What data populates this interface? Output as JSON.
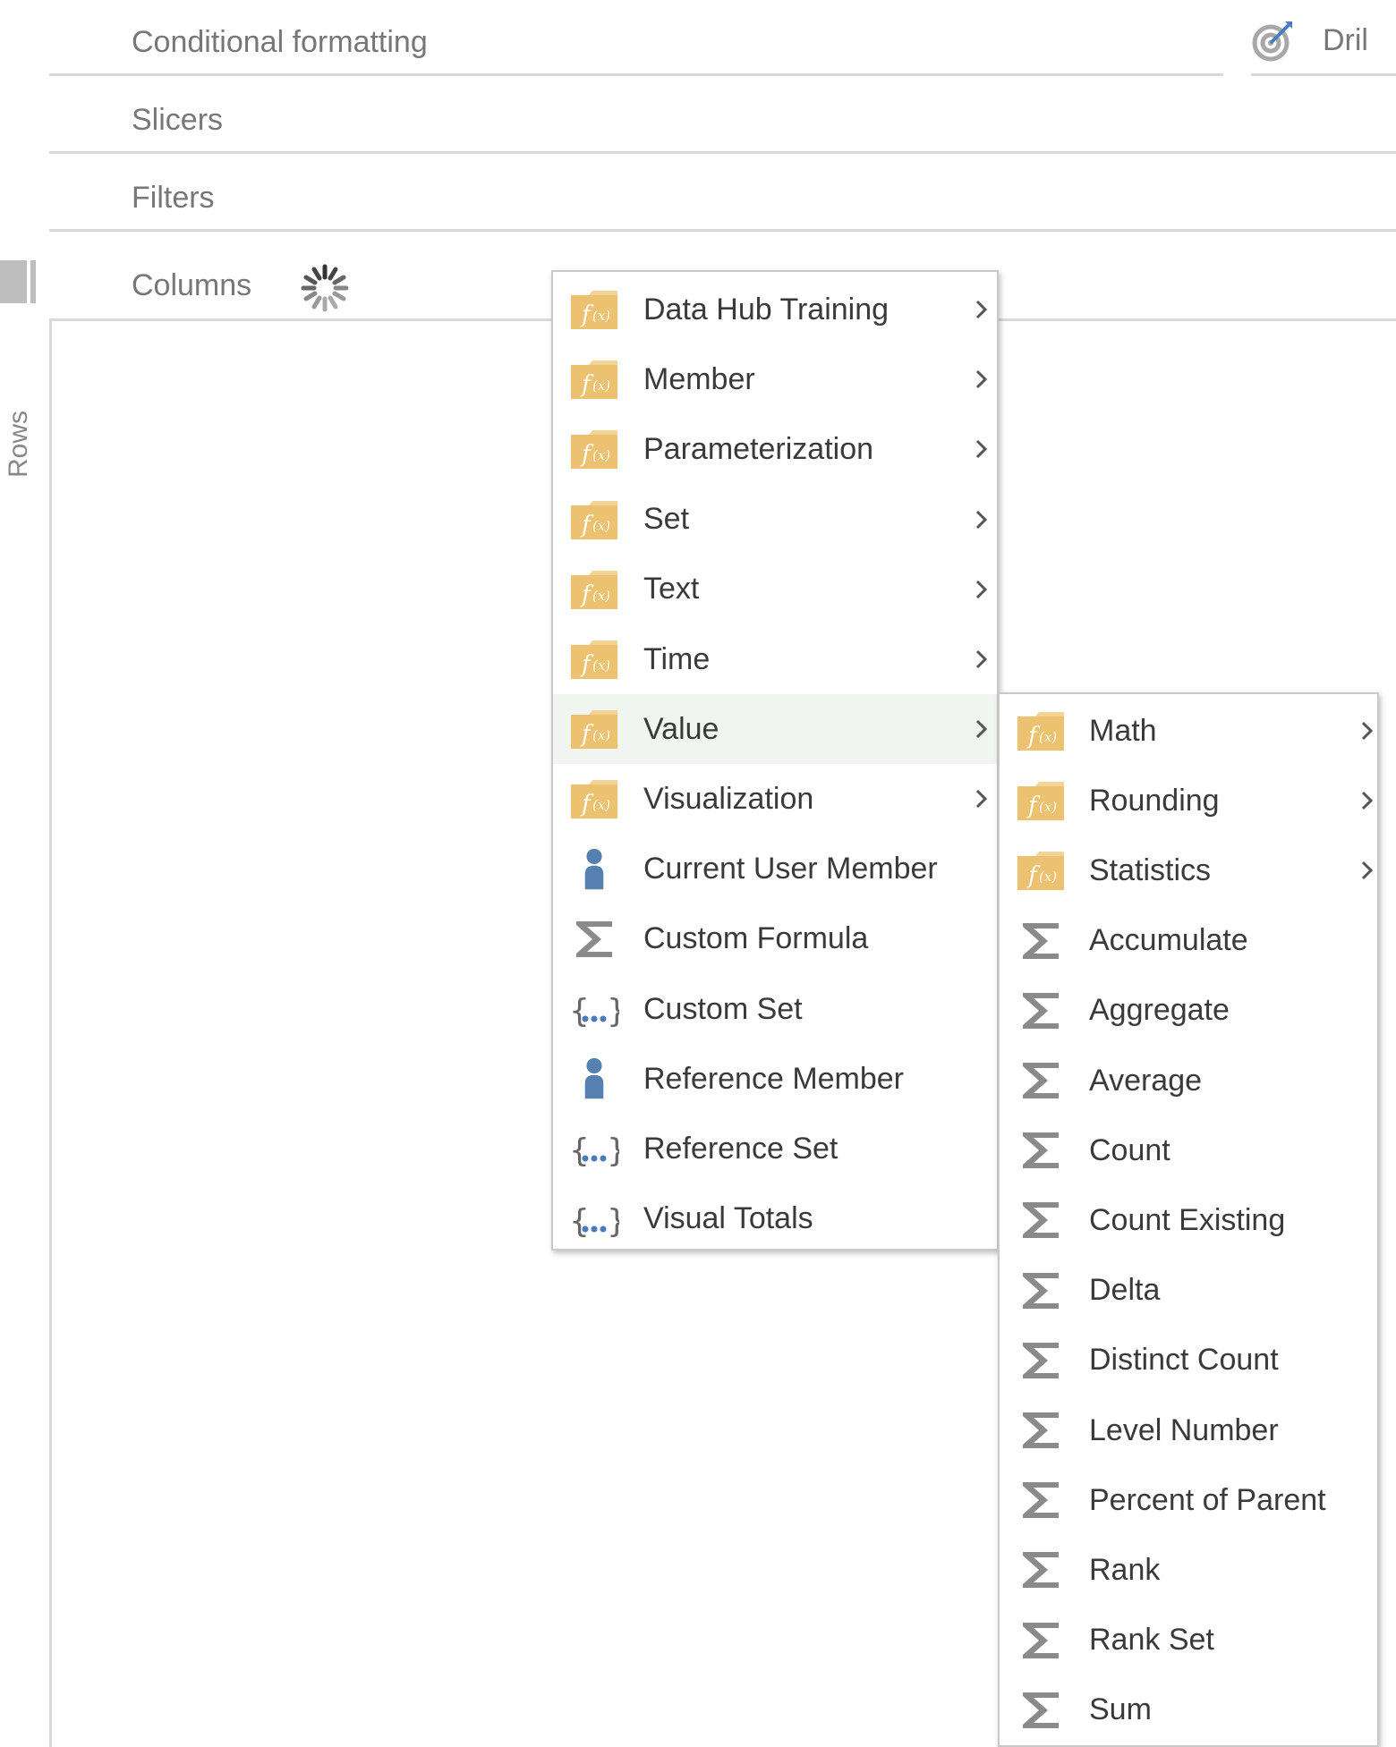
{
  "zones": {
    "conditional_formatting": "Conditional formatting",
    "slicers": "Slicers",
    "filters": "Filters",
    "columns": "Columns",
    "rows": "Rows"
  },
  "drill": {
    "label": "Dril",
    "icon": "target-dart-icon"
  },
  "menu": {
    "items": [
      {
        "label": "Data Hub Training",
        "icon": "function-folder-icon",
        "submenu": true
      },
      {
        "label": "Member",
        "icon": "function-folder-icon",
        "submenu": true
      },
      {
        "label": "Parameterization",
        "icon": "function-folder-icon",
        "submenu": true
      },
      {
        "label": "Set",
        "icon": "function-folder-icon",
        "submenu": true
      },
      {
        "label": "Text",
        "icon": "function-folder-icon",
        "submenu": true
      },
      {
        "label": "Time",
        "icon": "function-folder-icon",
        "submenu": true
      },
      {
        "label": "Value",
        "icon": "function-folder-icon",
        "submenu": true,
        "active": true
      },
      {
        "label": "Visualization",
        "icon": "function-folder-icon",
        "submenu": true
      },
      {
        "label": "Current User Member",
        "icon": "person-icon"
      },
      {
        "label": "Custom Formula",
        "icon": "sigma-icon"
      },
      {
        "label": "Custom Set",
        "icon": "set-braces-icon"
      },
      {
        "label": "Reference Member",
        "icon": "person-icon"
      },
      {
        "label": "Reference Set",
        "icon": "set-braces-icon"
      },
      {
        "label": "Visual Totals",
        "icon": "set-braces-icon"
      }
    ]
  },
  "submenu": {
    "items": [
      {
        "label": "Math",
        "icon": "function-folder-icon",
        "submenu": true
      },
      {
        "label": "Rounding",
        "icon": "function-folder-icon",
        "submenu": true
      },
      {
        "label": "Statistics",
        "icon": "function-folder-icon",
        "submenu": true
      },
      {
        "label": "Accumulate",
        "icon": "sigma-icon"
      },
      {
        "label": "Aggregate",
        "icon": "sigma-icon"
      },
      {
        "label": "Average",
        "icon": "sigma-icon"
      },
      {
        "label": "Count",
        "icon": "sigma-icon"
      },
      {
        "label": "Count Existing",
        "icon": "sigma-icon"
      },
      {
        "label": "Delta",
        "icon": "sigma-icon"
      },
      {
        "label": "Distinct Count",
        "icon": "sigma-icon"
      },
      {
        "label": "Level Number",
        "icon": "sigma-icon"
      },
      {
        "label": "Percent of Parent",
        "icon": "sigma-icon"
      },
      {
        "label": "Rank",
        "icon": "sigma-icon"
      },
      {
        "label": "Rank Set",
        "icon": "sigma-icon"
      },
      {
        "label": "Sum",
        "icon": "sigma-icon"
      }
    ]
  },
  "colors": {
    "folder": "#ecc16f",
    "person": "#5580b0",
    "sigma": "#8a8a8a",
    "dots": "#4a7bbd",
    "active_bg": "#f0f6ef"
  }
}
